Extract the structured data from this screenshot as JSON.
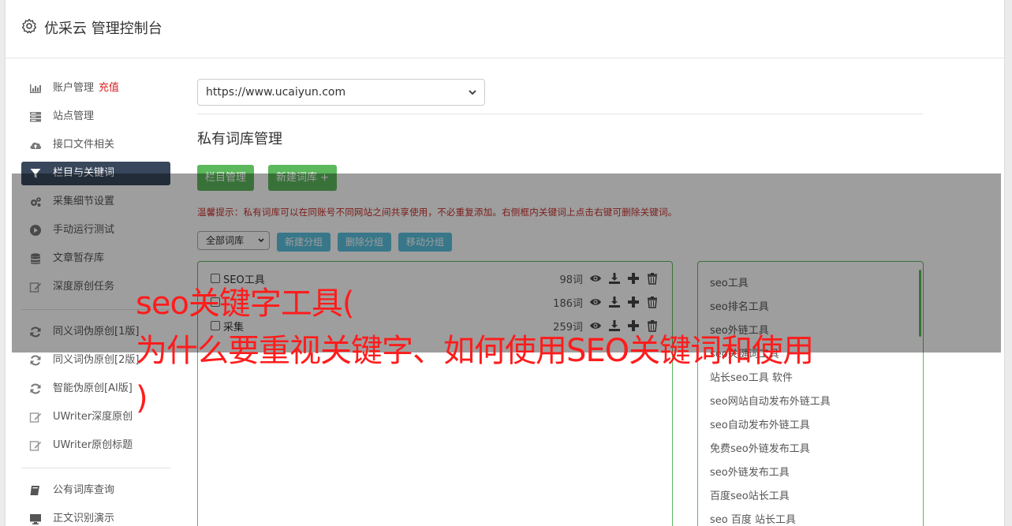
{
  "header": {
    "title": "优采云 管理控制台"
  },
  "sidebar": {
    "group1": [
      {
        "label": "账户管理",
        "extra": "充值",
        "icon": "bar-chart-icon"
      },
      {
        "label": "站点管理",
        "icon": "server-icon"
      },
      {
        "label": "接口文件相关",
        "icon": "cloud-upload-icon"
      },
      {
        "label": "栏目与关键词",
        "icon": "filter-icon",
        "active": true
      },
      {
        "label": "采集细节设置",
        "icon": "cogs-icon"
      },
      {
        "label": "手动运行测试",
        "icon": "play-circle-icon"
      },
      {
        "label": "文章暂存库",
        "icon": "database-icon"
      },
      {
        "label": "深度原创任务",
        "icon": "edit-icon"
      }
    ],
    "group2": [
      {
        "label": "同义词伪原创[1版]",
        "icon": "refresh-icon"
      },
      {
        "label": "同义词伪原创[2版]",
        "icon": "refresh-icon"
      },
      {
        "label": "智能伪原创[AI版]",
        "icon": "refresh-icon"
      },
      {
        "label": "UWriter深度原创",
        "icon": "edit-icon"
      },
      {
        "label": "UWriter原创标题",
        "icon": "edit-icon"
      }
    ],
    "group3": [
      {
        "label": "公有词库查询",
        "icon": "book-icon"
      },
      {
        "label": "正文识别演示",
        "icon": "monitor-icon"
      }
    ]
  },
  "main": {
    "site_select": "https://www.ucaiyun.com",
    "section_title": "私有词库管理",
    "buttons": {
      "column_manage": "栏目管理",
      "new_library": "新建词库 +"
    },
    "tip": "温馨提示：私有词库可以在同账号不同网站之间共享使用，不必重复添加。右侧框内关键词上点击右键可删除关键词。",
    "group_select": "全部词库",
    "group_buttons": {
      "new_group": "新建分组",
      "delete_group": "删除分组",
      "move_group": "移动分组"
    },
    "libraries": [
      {
        "name": "SEO工具",
        "count": "98词"
      },
      {
        "name": "",
        "count": "186词"
      },
      {
        "name": "采集",
        "count": "259词"
      }
    ],
    "keywords": [
      "seo工具",
      "seo排名工具",
      "seo外链工具",
      "seo关键词工具",
      "站长seo工具 软件",
      "seo网站自动发布外链工具",
      "seo自动发布外链工具",
      "免费seo外链发布工具",
      "seo外链发布工具",
      "百度seo站长工具",
      "seo 百度 站长工具"
    ]
  },
  "overlay": {
    "line1": "seo关键字工具(",
    "line2": "为什么要重视关键字、如何使用SEO关键词和使用",
    "line3": ")"
  },
  "colors": {
    "sidebar_active": "#38475b",
    "btn_green": "#5cb85c",
    "btn_blue": "#5bc0de",
    "tip_red": "#c9302c",
    "overlay_red": "#ff1c1c"
  }
}
